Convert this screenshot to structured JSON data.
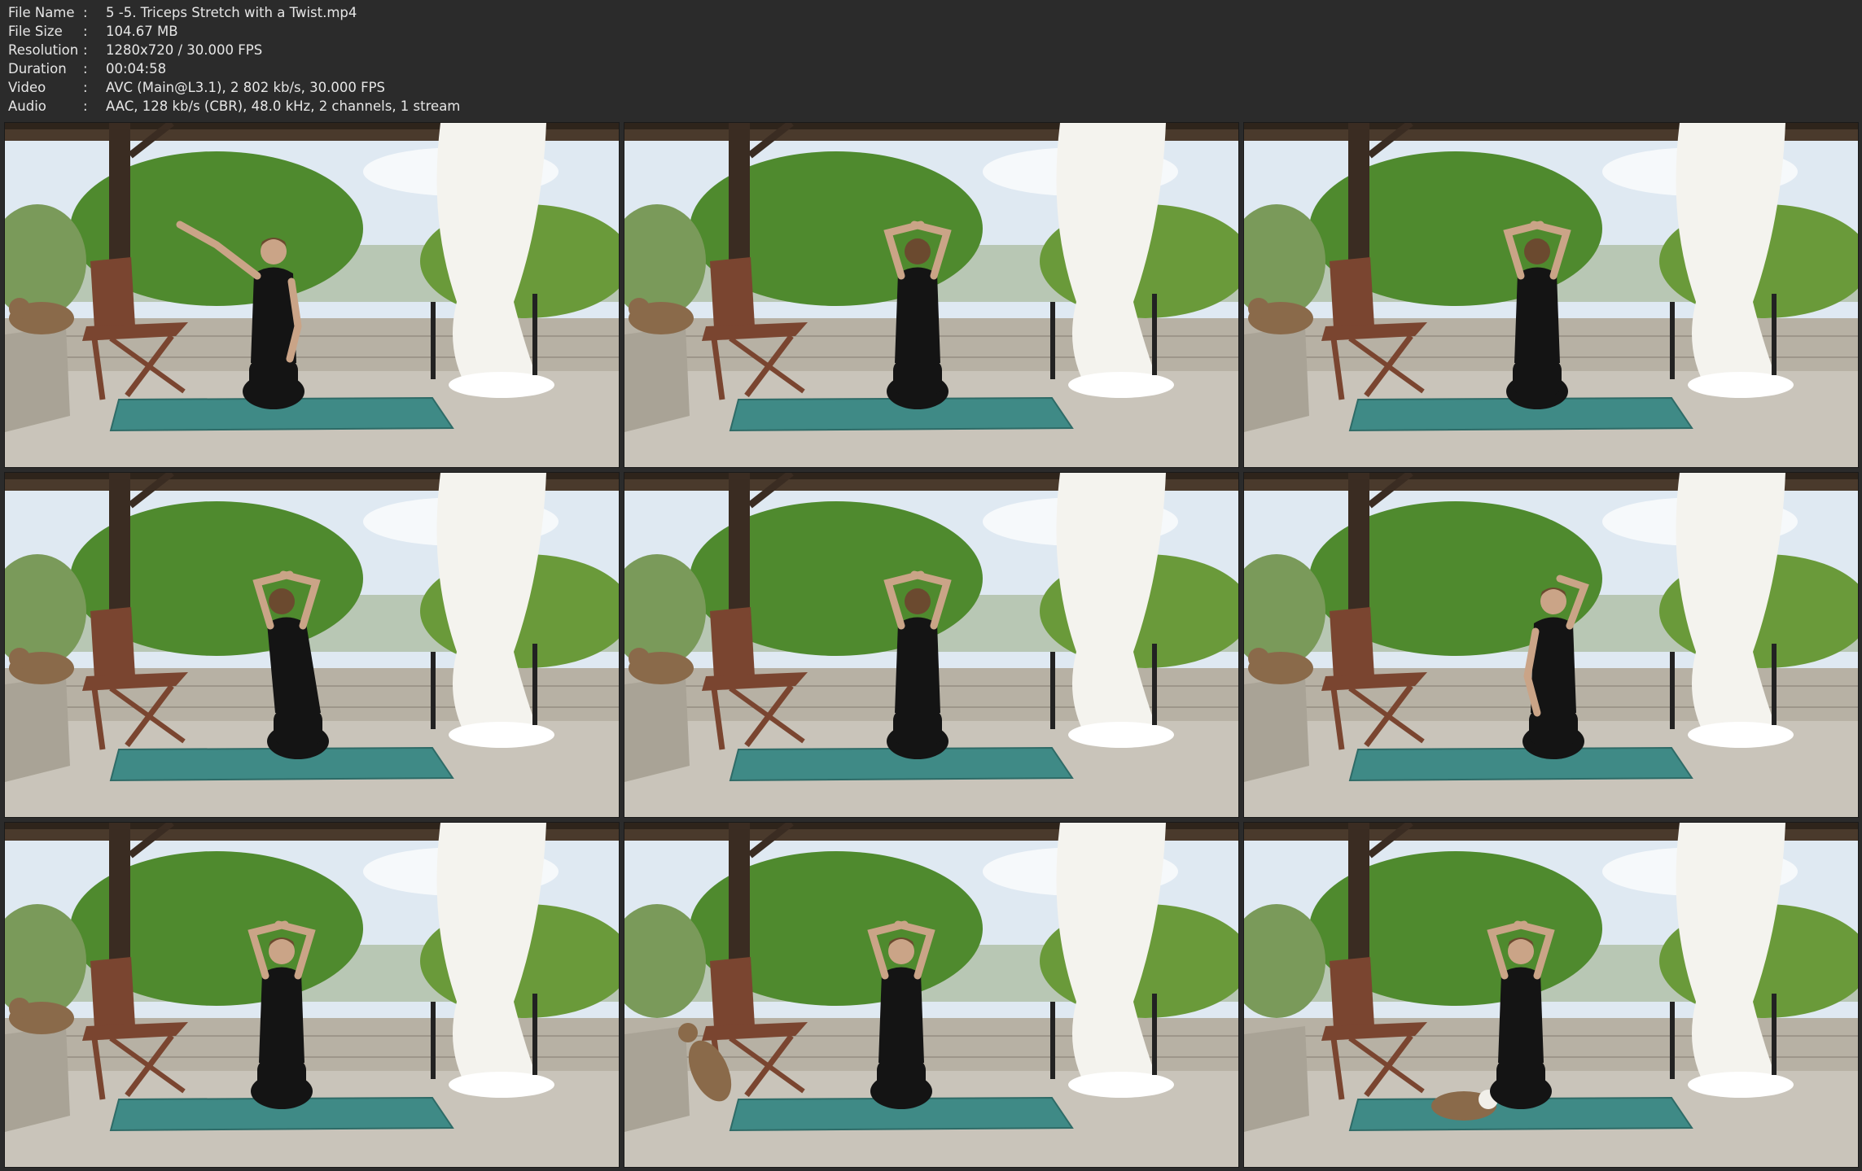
{
  "info": {
    "rows": [
      {
        "label": "File Name",
        "value": "5 -5. Triceps Stretch with a Twist.mp4"
      },
      {
        "label": "File Size",
        "value": "104.67 MB"
      },
      {
        "label": "Resolution",
        "value": "1280x720 / 30.000 FPS"
      },
      {
        "label": "Duration",
        "value": "00:04:58"
      },
      {
        "label": "Video",
        "value": "AVC (Main@L3.1), 2 802 kb/s, 30.000 FPS"
      },
      {
        "label": "Audio",
        "value": "AAC, 128 kb/s (CBR), 48.0 kHz, 2 channels, 1 stream"
      }
    ],
    "separator": ":"
  },
  "thumbnails": [
    {
      "pose": "arm-out",
      "cat": "wall"
    },
    {
      "pose": "back-arms-up",
      "cat": "wall"
    },
    {
      "pose": "twist-arms-up",
      "cat": "wall"
    },
    {
      "pose": "twist-lean",
      "cat": "wall"
    },
    {
      "pose": "back-arms-up",
      "cat": "wall"
    },
    {
      "pose": "front-one-arm",
      "cat": "wall"
    },
    {
      "pose": "front-arms-up",
      "cat": "wall"
    },
    {
      "pose": "front-arms-up",
      "cat": "jumping"
    },
    {
      "pose": "front-arms-up",
      "cat": "mat"
    }
  ],
  "colors": {
    "background": "#2b2b2b",
    "text": "#e6e6e6",
    "mat": "#3f8a86",
    "foliage": "#4f8a2e",
    "sky": "#dfe9f2",
    "wall": "#b7b1a4",
    "floor": "#c9c4ba",
    "roof": "#4a3a2c",
    "post": "#3a2c22",
    "chair": "#7a4530",
    "curtain": "#f4f3ee",
    "outfit": "#141414",
    "skin": "#caa487",
    "hair": "#6b4a2f",
    "cat": "#8a6a4a"
  }
}
